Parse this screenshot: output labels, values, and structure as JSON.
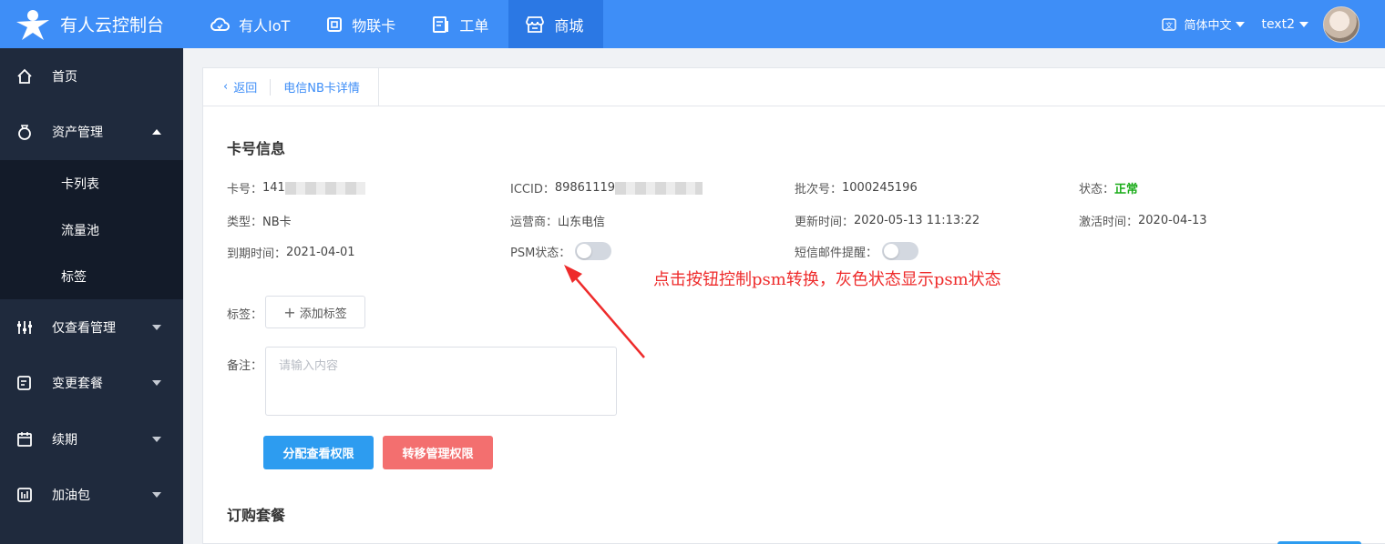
{
  "brand": {
    "title": "有人云控制台"
  },
  "nav": [
    {
      "label": "有人IoT",
      "icon": "cloud-icon",
      "active": false
    },
    {
      "label": "物联卡",
      "icon": "sim-card-icon",
      "active": false
    },
    {
      "label": "工单",
      "icon": "ticket-icon",
      "active": false
    },
    {
      "label": "商城",
      "icon": "store-icon",
      "active": true
    }
  ],
  "header": {
    "language": "简体中文",
    "username": "text2"
  },
  "sidebar": {
    "items": [
      {
        "label": "首页",
        "icon": "home-icon"
      },
      {
        "label": "资产管理",
        "icon": "asset-bag-icon",
        "expanded": true,
        "children": [
          {
            "label": "卡列表"
          },
          {
            "label": "流量池"
          },
          {
            "label": "标签"
          }
        ]
      },
      {
        "label": "仅查看管理",
        "icon": "sliders-icon"
      },
      {
        "label": "变更套餐",
        "icon": "edit-plan-icon"
      },
      {
        "label": "续期",
        "icon": "calendar-icon"
      },
      {
        "label": "加油包",
        "icon": "chart-box-icon"
      }
    ]
  },
  "tabs": {
    "back_label": "返回",
    "current": "电信NB卡详情"
  },
  "card_info": {
    "title": "卡号信息",
    "card_no": {
      "label": "卡号：",
      "value": "141"
    },
    "iccid": {
      "label": "ICCID：",
      "value": "89861119"
    },
    "batch": {
      "label": "批次号：",
      "value": "1000245196"
    },
    "status": {
      "label": "状态：",
      "value": "正常"
    },
    "type": {
      "label": "类型：",
      "value": "NB卡"
    },
    "carrier": {
      "label": "运营商：",
      "value": "山东电信"
    },
    "updated": {
      "label": "更新时间：",
      "value": "2020-05-13 11:13:22"
    },
    "activated": {
      "label": "激活时间：",
      "value": "2020-04-13"
    },
    "expiry": {
      "label": "到期时间：",
      "value": "2021-04-01"
    },
    "psm": {
      "label": "PSM状态：",
      "on": false
    },
    "sms_alert": {
      "label": "短信邮件提醒：",
      "on": false
    }
  },
  "form": {
    "tag_label": "标签：",
    "add_tag_label": "添加标签",
    "remark_label": "备注：",
    "remark_placeholder": "请输入内容",
    "assign_view_label": "分配查看权限",
    "transfer_manage_label": "转移管理权限"
  },
  "annotation": {
    "text": "点击按钮控制psm转换，灰色状态显示psm状态",
    "color": "#ee2b2b"
  },
  "subscription": {
    "title": "订购套餐"
  },
  "colors": {
    "topbar": "#3e8ef7",
    "sidebar": "#1f2a3d",
    "accent": "#3e8ef7",
    "ok": "#1aac19",
    "danger_button": "#f36f6f",
    "primary_button": "#2d9cf0"
  }
}
